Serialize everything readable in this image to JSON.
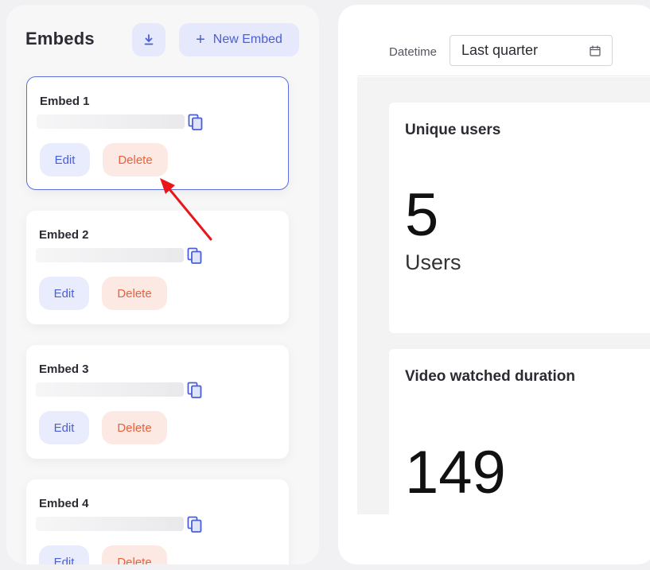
{
  "embeds_panel": {
    "title": "Embeds",
    "new_embed_label": "New Embed",
    "embeds": [
      {
        "name": "Embed 1",
        "edit_label": "Edit",
        "delete_label": "Delete",
        "selected": true
      },
      {
        "name": "Embed 2",
        "edit_label": "Edit",
        "delete_label": "Delete",
        "selected": false
      },
      {
        "name": "Embed 3",
        "edit_label": "Edit",
        "delete_label": "Delete",
        "selected": false
      },
      {
        "name": "Embed 4",
        "edit_label": "Edit",
        "delete_label": "Delete",
        "selected": false
      }
    ]
  },
  "analytics": {
    "filter_label": "Datetime",
    "date_range": "Last quarter",
    "metrics": [
      {
        "title": "Unique users",
        "value": "5",
        "unit": "Users"
      },
      {
        "title": "Video watched duration",
        "value": "149"
      }
    ]
  },
  "colors": {
    "accent": "#4a5fd6",
    "danger": "#e8613c",
    "annotation": "#e8161b"
  }
}
